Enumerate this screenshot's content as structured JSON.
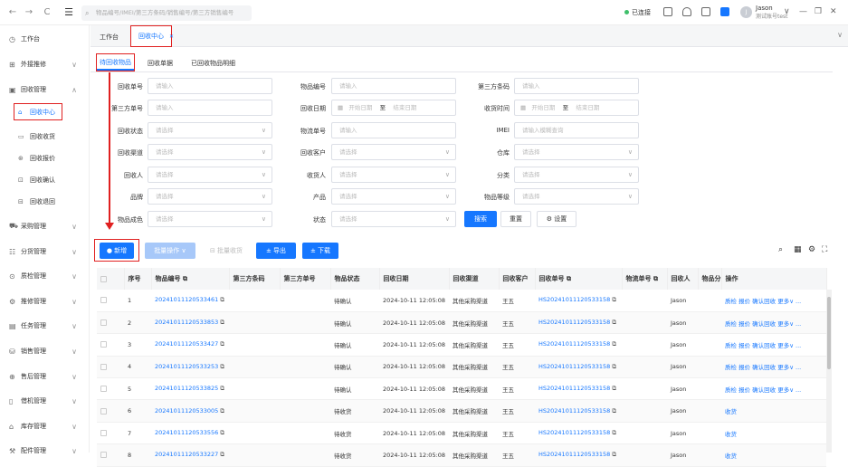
{
  "topbar": {
    "back": "←",
    "forward": "→",
    "refresh": "C",
    "menu": "☰",
    "search_placeholder": "物品编号/IMEI/第三方条码/销售编号/第三方销售编号",
    "connection": "已连接",
    "user_name": "Jason",
    "user_role": "测试账号test",
    "minimize": "—",
    "restore": "❐",
    "close": "✕"
  },
  "sidebar": {
    "items": [
      {
        "label": "工作台",
        "icon": "dashboard-icon",
        "has_arrow": false
      },
      {
        "label": "外接推修",
        "icon": "external-repair-icon",
        "has_arrow": true
      },
      {
        "label": "回收管理",
        "icon": "recycle-manage-icon",
        "has_arrow": true,
        "expanded": true
      },
      {
        "label": "采购管理",
        "icon": "purchase-icon",
        "has_arrow": true
      },
      {
        "label": "分货管理",
        "icon": "distribution-icon",
        "has_arrow": true
      },
      {
        "label": "质检管理",
        "icon": "inspection-icon",
        "has_arrow": true
      },
      {
        "label": "推修管理",
        "icon": "repair-icon",
        "has_arrow": true
      },
      {
        "label": "任务管理",
        "icon": "task-icon",
        "has_arrow": true
      },
      {
        "label": "销售管理",
        "icon": "sales-icon",
        "has_arrow": true
      },
      {
        "label": "售后管理",
        "icon": "aftersale-icon",
        "has_arrow": true
      },
      {
        "label": "借机管理",
        "icon": "loan-icon",
        "has_arrow": true
      },
      {
        "label": "库存管理",
        "icon": "inventory-icon",
        "has_arrow": true
      },
      {
        "label": "配件管理",
        "icon": "parts-icon",
        "has_arrow": true
      }
    ],
    "subitems": [
      {
        "label": "回收中心",
        "icon": "recycle-center-icon",
        "active": true
      },
      {
        "label": "回收收货",
        "icon": "receive-icon"
      },
      {
        "label": "回收报价",
        "icon": "quote-icon"
      },
      {
        "label": "回收确认",
        "icon": "confirm-icon"
      },
      {
        "label": "回收退回",
        "icon": "return-icon"
      }
    ]
  },
  "tabs": [
    {
      "label": "工作台"
    },
    {
      "label": "回收中心"
    }
  ],
  "subtabs": [
    {
      "label": "待回收物品"
    },
    {
      "label": "回收单据"
    },
    {
      "label": "已回收物品明细"
    }
  ],
  "filters": {
    "recycle_no": {
      "label": "回收单号",
      "placeholder": "请输入"
    },
    "item_no": {
      "label": "物品编号",
      "placeholder": "请输入"
    },
    "third_barcode": {
      "label": "第三方条码",
      "placeholder": "请输入"
    },
    "third_no": {
      "label": "第三方单号",
      "placeholder": "请输入"
    },
    "recycle_date": {
      "label": "回收日期",
      "start": "开始日期",
      "sep": "至",
      "end": "结束日期"
    },
    "receive_time": {
      "label": "收货时间",
      "start": "开始日期",
      "sep": "至",
      "end": "结束日期"
    },
    "recycle_status": {
      "label": "回收状态",
      "placeholder": "请选择"
    },
    "logistics_no": {
      "label": "物流单号",
      "placeholder": "请输入"
    },
    "imei": {
      "label": "IMEI",
      "placeholder": "请输入模糊查询"
    },
    "channel": {
      "label": "回收渠道",
      "placeholder": "请选择"
    },
    "customer": {
      "label": "回收客户",
      "placeholder": "请选择"
    },
    "warehouse": {
      "label": "仓库",
      "placeholder": "请选择"
    },
    "recycler": {
      "label": "回收人",
      "placeholder": "请选择"
    },
    "receiver": {
      "label": "收货人",
      "placeholder": "请选择"
    },
    "category": {
      "label": "分类",
      "placeholder": "请选择"
    },
    "brand": {
      "label": "品牌",
      "placeholder": "请选择"
    },
    "product": {
      "label": "产品",
      "placeholder": "请选择"
    },
    "grade": {
      "label": "物品等级",
      "placeholder": "请选择"
    },
    "condition": {
      "label": "物品成色",
      "placeholder": "请选择"
    },
    "status": {
      "label": "状态",
      "placeholder": "请选择"
    },
    "search_btn": "搜索",
    "reset_btn": "重置",
    "settings_btn": "⚙ 设置"
  },
  "toolbar": {
    "add": "新增",
    "batch": "批量操作",
    "batch_receive": "批量收货",
    "export": "导出",
    "download": "下载"
  },
  "table": {
    "headers": [
      "",
      "序号",
      "物品编号",
      "第三方条码",
      "第三方单号",
      "物品状态",
      "回收日期",
      "回收渠道",
      "回收客户",
      "回收单号",
      "物流单号",
      "回收人",
      "物品分",
      "操作"
    ],
    "rows": [
      {
        "no": "1",
        "item": "20241011120533461",
        "status": "待确认",
        "date": "2024-10-11 12:05:08",
        "channel": "其他采购渠道",
        "customer": "王五",
        "order": "HS20241011120533158",
        "user": "Jason",
        "ops": "质检  报价  确认回收  更多∨ ..."
      },
      {
        "no": "2",
        "item": "20241011120533853",
        "status": "待确认",
        "date": "2024-10-11 12:05:08",
        "channel": "其他采购渠道",
        "customer": "王五",
        "order": "HS20241011120533158",
        "user": "Jason",
        "ops": "质检  报价  确认回收  更多∨ ..."
      },
      {
        "no": "3",
        "item": "20241011120533427",
        "status": "待确认",
        "date": "2024-10-11 12:05:08",
        "channel": "其他采购渠道",
        "customer": "王五",
        "order": "HS20241011120533158",
        "user": "Jason",
        "ops": "质检  报价  确认回收  更多∨ ..."
      },
      {
        "no": "4",
        "item": "20241011120533253",
        "status": "待确认",
        "date": "2024-10-11 12:05:08",
        "channel": "其他采购渠道",
        "customer": "王五",
        "order": "HS20241011120533158",
        "user": "Jason",
        "ops": "质检  报价  确认回收  更多∨ ..."
      },
      {
        "no": "5",
        "item": "20241011120533825",
        "status": "待确认",
        "date": "2024-10-11 12:05:08",
        "channel": "其他采购渠道",
        "customer": "王五",
        "order": "HS20241011120533158",
        "user": "Jason",
        "ops": "质检  报价  确认回收  更多∨ ..."
      },
      {
        "no": "6",
        "item": "20241011120533005",
        "status": "待收货",
        "date": "2024-10-11 12:05:08",
        "channel": "其他采购渠道",
        "customer": "王五",
        "order": "HS20241011120533158",
        "user": "Jason",
        "ops": "收货"
      },
      {
        "no": "7",
        "item": "20241011120533556",
        "status": "待收货",
        "date": "2024-10-11 12:05:08",
        "channel": "其他采购渠道",
        "customer": "王五",
        "order": "HS20241011120533158",
        "user": "Jason",
        "ops": "收货"
      },
      {
        "no": "8",
        "item": "20241011120533227",
        "status": "待收货",
        "date": "2024-10-11 12:05:08",
        "channel": "其他采购渠道",
        "customer": "王五",
        "order": "HS20241011120533158",
        "user": "Jason",
        "ops": "收货"
      }
    ]
  }
}
